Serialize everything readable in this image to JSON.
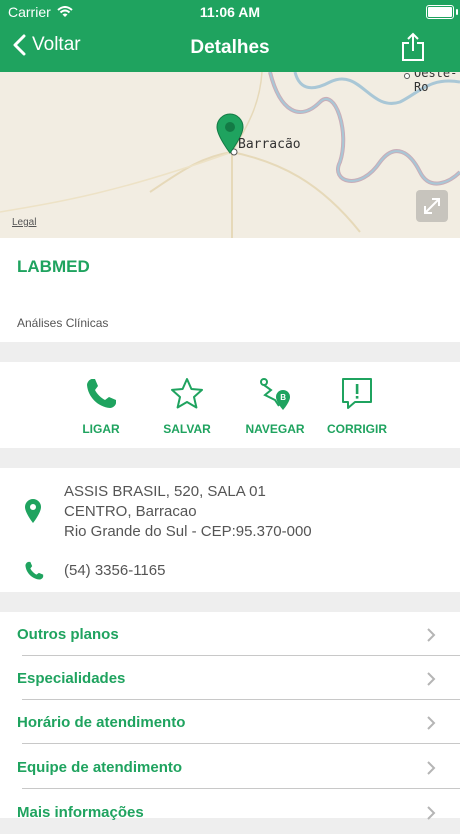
{
  "status_bar": {
    "carrier": "Carrier",
    "time": "11:06 AM"
  },
  "nav": {
    "back_label": "Voltar",
    "title": "Detalhes"
  },
  "map": {
    "city_label": "Barracão",
    "city_label_2": "Oeste-Ro",
    "legal_label": "Legal"
  },
  "provider": {
    "name": "LABMED",
    "category": "Análises Clínicas"
  },
  "actions": [
    {
      "label": "LIGAR",
      "icon": "phone-icon"
    },
    {
      "label": "SALVAR",
      "icon": "star-icon"
    },
    {
      "label": "NAVEGAR",
      "icon": "route-icon"
    },
    {
      "label": "CORRIGIR",
      "icon": "report-icon"
    }
  ],
  "address": {
    "line1": "ASSIS BRASIL, 520, SALA 01",
    "line2": "CENTRO, Barracao",
    "line3": "Rio Grande do Sul - CEP:95.370-000",
    "phone": "(54) 3356-1165"
  },
  "menu": [
    {
      "label": "Outros planos"
    },
    {
      "label": "Especialidades"
    },
    {
      "label": "Horário de atendimento"
    },
    {
      "label": "Equipe de atendimento"
    },
    {
      "label": "Mais informações"
    }
  ],
  "colors": {
    "brand": "#1fa35f",
    "map_bg": "#f2ede2",
    "river": "#a9c7d6",
    "border_line": "#c9adb8"
  }
}
